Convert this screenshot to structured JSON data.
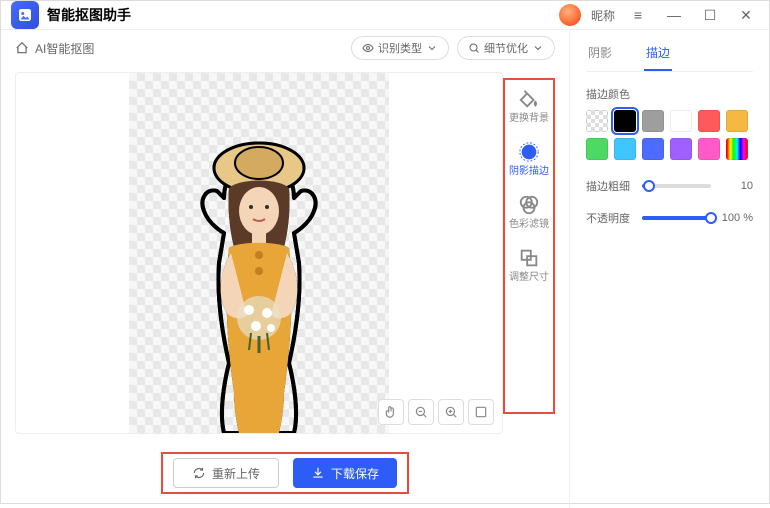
{
  "header": {
    "title": "智能抠图助手",
    "nickname": "昵称"
  },
  "breadcrumb": {
    "label": "AI智能抠图"
  },
  "toolbar": {
    "recognize_type": "识别类型",
    "detail_optimize": "细节优化"
  },
  "tool_column": {
    "items": [
      {
        "label": "更换背景"
      },
      {
        "label": "阴影描边"
      },
      {
        "label": "色彩滤镜"
      },
      {
        "label": "调整尺寸"
      }
    ]
  },
  "bottom": {
    "reupload": "重新上传",
    "download": "下载保存"
  },
  "right_panel": {
    "tabs": [
      {
        "label": "阴影",
        "active": false
      },
      {
        "label": "描边",
        "active": true
      }
    ],
    "stroke_color_label": "描边颜色",
    "swatches": [
      {
        "color": "transparent",
        "selected": false
      },
      {
        "color": "#000000",
        "selected": true
      },
      {
        "color": "#9e9e9e",
        "selected": false
      },
      {
        "color": "#ffffff",
        "selected": false
      },
      {
        "color": "#ff5a5a",
        "selected": false
      },
      {
        "color": "#f5b941",
        "selected": false
      },
      {
        "color": "#4cd964",
        "selected": false
      },
      {
        "color": "#3fc6ff",
        "selected": false
      },
      {
        "color": "#4d6cff",
        "selected": false
      },
      {
        "color": "#a060ff",
        "selected": false
      },
      {
        "color": "#ff5ac8",
        "selected": false
      },
      {
        "color": "rainbow",
        "selected": false
      }
    ],
    "thickness_label": "描边粗细",
    "thickness_value": "10",
    "thickness_percent": 10,
    "opacity_label": "不透明度",
    "opacity_value": "100 %",
    "opacity_percent": 100
  }
}
